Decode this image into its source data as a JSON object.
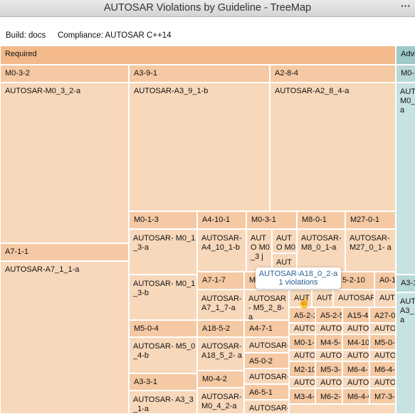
{
  "window": {
    "title": "AUTOSAR Violations by Guideline - TreeMap",
    "menu_glyph": "···"
  },
  "info": {
    "build": "Build: docs",
    "compliance": "Compliance: AUTOSAR C++14"
  },
  "colors": {
    "header": "#f3b98b",
    "group": "#f5c9a3",
    "leaf": "#f8d8bb",
    "advisory": "#9fc9c9"
  },
  "categories": {
    "required": "Required",
    "advisory": "Advi"
  },
  "groups": {
    "m0_3_2": "M0-3-2",
    "a3_9_1": "A3-9-1",
    "a2_8_4": "A2-8-4",
    "m0_adv": "M0-",
    "a7_1_1": "A7-1-1",
    "m0_1_3": "M0-1-3",
    "a4_10_1": "A4-10-1",
    "m0_3_1": "M0-3-1",
    "m8_0_1": "M8-0-1",
    "m27_0_1": "M27-0-1",
    "a7_1_7": "A7-1-7",
    "m5": "M5",
    "r5_2_10": "5-2-10",
    "a0_1": "A0-1",
    "a3_1": "A3-1",
    "m5_0_4": "M5-0-4",
    "a18_5_2": "A18-5-2",
    "a4_7_1": "A4-7-1",
    "a5_0_2": "A5-0-2",
    "a3_3_1": "A3-3-1",
    "m0_4_2": "M0-4-2",
    "a6_5_1": "A6-5-1"
  },
  "leaves": {
    "l1": "AUTOSAR-M0_3_2-a",
    "l2": "AUTOSAR-A3_9_1-b",
    "l3": "AUTOSAR-A2_8_4-a",
    "l4": "AUT M0_ a",
    "l5": "AUTOSAR-A7_1_1-a",
    "l6": "AUTOSAR- M0_1_3-a",
    "l7": "AUTOSAR- A4_10_1-b",
    "l8": "AUTO M0_3 j",
    "l9": "AUTO M0 3",
    "l10": "AUTO",
    "l11": "AUTOSAR- M8_0_1-a",
    "l12": "AUTOSAR- M27_0_1- a",
    "l13": "AUTOSAR- M0_1_3-b",
    "l14": "AUTOSAR- A7_1_7-a",
    "l15": "AUTOSAR- M5_2_8-a",
    "l16": "AUT",
    "l17": "AUT",
    "l18": "AUTOSAR",
    "l19": "AUT",
    "l20": "AUT A3_ a",
    "l21": "AUTOSAR- M5_0_4-b",
    "l22": "AUTOSAR- A18_5_2- a",
    "l23": "AUTOSAR-",
    "l24": "AUTOSAR-",
    "l25": "AUTOSAR- A3_3_1-a",
    "l26": "AUTOSAR- M0_4_2-a",
    "l27": "AUTOSAR-",
    "l28": "AUTOSAR-"
  },
  "small": {
    "s1": "A5-2-2",
    "s2": "A5-2-5",
    "s3": "A15-4",
    "s4": "A27-0",
    "s5": "AUTO",
    "s6": "AUTO",
    "s7": "AUTO",
    "s8": "AUTO",
    "s9": "M0-1-",
    "s10": "M4-5-",
    "s11": "M4-10",
    "s12": "M5-0-",
    "s13": "AUTO",
    "s14": "AUTO",
    "s15": "AUTO",
    "s16": "AUTO",
    "s17": "M2-10",
    "s18": "M5-3-",
    "s19": "M6-4-",
    "s20": "M6-4-",
    "s21": "AUTO",
    "s22": "AUTO",
    "s23": "AUTO",
    "s24": "AUTO",
    "s25": "M3-4-",
    "s26": "M6-2-",
    "s27": "M6-4-6",
    "s28": "M7-3-"
  },
  "tooltip": {
    "name": "AUTOSAR-A18_0_2-a",
    "count": "1 violations"
  }
}
